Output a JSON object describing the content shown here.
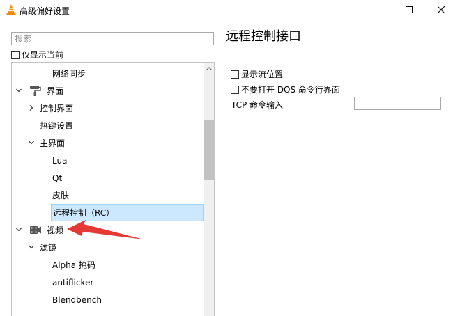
{
  "window": {
    "title": "高级偏好设置",
    "minimize_glyph": "—",
    "maximize_glyph": "☐",
    "close_glyph": "✕"
  },
  "search": {
    "placeholder": "搜索",
    "value": ""
  },
  "show_current_only": {
    "label": "仅显示当前",
    "checked": false
  },
  "tree": {
    "items": [
      {
        "label": "网络同步",
        "depth": 2,
        "expander": "none",
        "icon": "none"
      },
      {
        "label": "界面",
        "depth": 0,
        "expander": "expanded",
        "icon": "paint-roller-icon"
      },
      {
        "label": "控制界面",
        "depth": 1,
        "expander": "collapsed",
        "icon": "none"
      },
      {
        "label": "热键设置",
        "depth": 1,
        "expander": "none",
        "icon": "none"
      },
      {
        "label": "主界面",
        "depth": 1,
        "expander": "expanded",
        "icon": "none"
      },
      {
        "label": "Lua",
        "depth": 2,
        "expander": "none",
        "icon": "none"
      },
      {
        "label": "Qt",
        "depth": 2,
        "expander": "none",
        "icon": "none"
      },
      {
        "label": "皮肤",
        "depth": 2,
        "expander": "none",
        "icon": "none"
      },
      {
        "label": "远程控制（RC）",
        "depth": 2,
        "expander": "none",
        "icon": "none",
        "selected": true
      },
      {
        "label": "视频",
        "depth": 0,
        "expander": "expanded",
        "icon": "video-icon"
      },
      {
        "label": "滤镜",
        "depth": 1,
        "expander": "expanded",
        "icon": "none"
      },
      {
        "label": "Alpha 掩码",
        "depth": 2,
        "expander": "none",
        "icon": "none"
      },
      {
        "label": "antiflicker",
        "depth": 2,
        "expander": "none",
        "icon": "none"
      },
      {
        "label": "Blendbench",
        "depth": 2,
        "expander": "none",
        "icon": "none"
      }
    ]
  },
  "panel": {
    "title": "远程控制接口",
    "options": [
      {
        "label": "显示流位置",
        "checked": false
      },
      {
        "label": "不要打开 DOS 命令行界面",
        "checked": false
      }
    ],
    "tcp_label": "TCP 命令输入",
    "tcp_value": ""
  },
  "colors": {
    "selection_bg": "#cce8ff",
    "selection_border": "#99d1ff",
    "annotation_arrow": "#e53935",
    "vlc_cone": "#f28c00"
  }
}
